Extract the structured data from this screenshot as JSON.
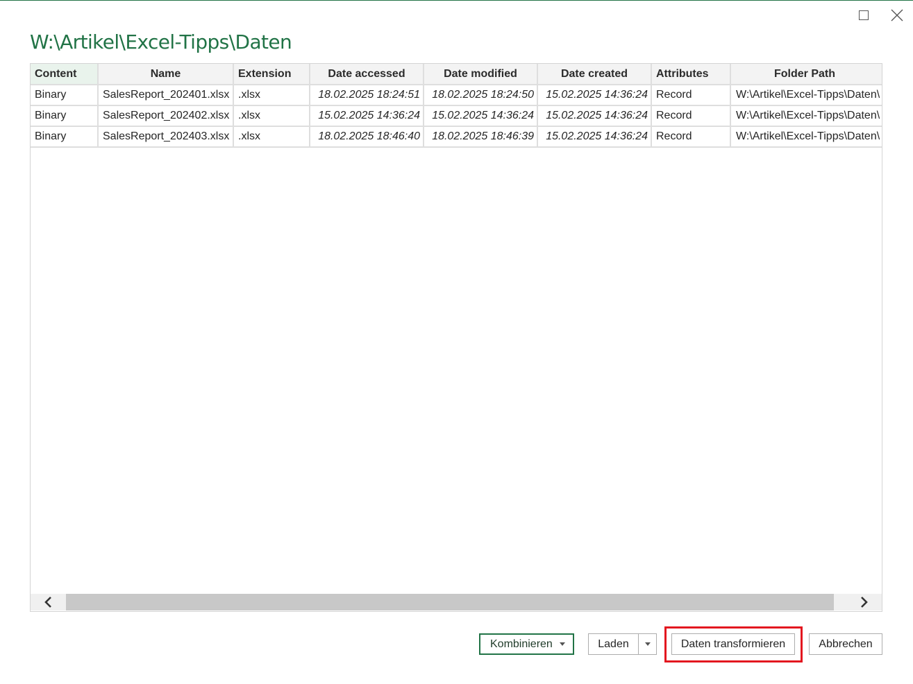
{
  "dialog": {
    "title": "W:\\Artikel\\Excel-Tipps\\Daten"
  },
  "table": {
    "columns": [
      "Content",
      "Name",
      "Extension",
      "Date accessed",
      "Date modified",
      "Date created",
      "Attributes",
      "Folder Path"
    ],
    "rows": [
      [
        "Binary",
        "SalesReport_202401.xlsx",
        ".xlsx",
        "18.02.2025 18:24:51",
        "18.02.2025 18:24:50",
        "15.02.2025 14:36:24",
        "Record",
        "W:\\Artikel\\Excel-Tipps\\Daten\\"
      ],
      [
        "Binary",
        "SalesReport_202402.xlsx",
        ".xlsx",
        "15.02.2025 14:36:24",
        "15.02.2025 14:36:24",
        "15.02.2025 14:36:24",
        "Record",
        "W:\\Artikel\\Excel-Tipps\\Daten\\"
      ],
      [
        "Binary",
        "SalesReport_202403.xlsx",
        ".xlsx",
        "18.02.2025 18:46:40",
        "18.02.2025 18:46:39",
        "15.02.2025 14:36:24",
        "Record",
        "W:\\Artikel\\Excel-Tipps\\Daten\\"
      ]
    ]
  },
  "buttons": {
    "combine": "Kombinieren",
    "load": "Laden",
    "transform": "Daten transformieren",
    "cancel": "Abbrechen"
  },
  "icons": {
    "maximize": "maximize-icon",
    "close": "close-icon",
    "scroll_left": "chevron-left-icon",
    "scroll_right": "chevron-right-icon",
    "dropdown": "caret-down-icon"
  },
  "colors": {
    "accent": "#217346",
    "highlight": "#e3171f",
    "header_bg": "#f3f3f3",
    "selected_header_bg": "#e9f3ec"
  }
}
